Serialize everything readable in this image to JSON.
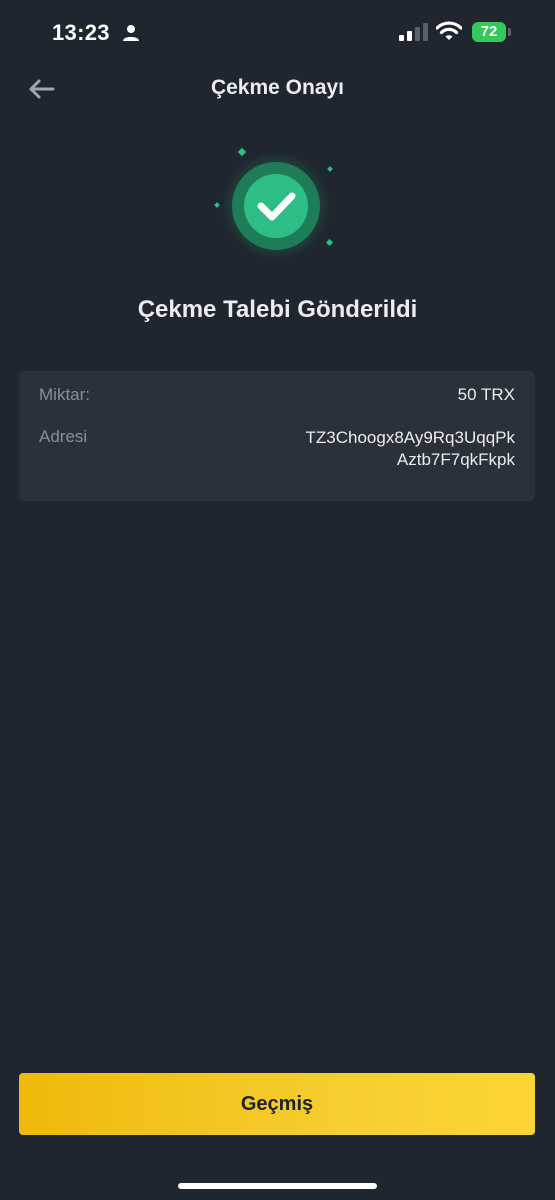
{
  "status_bar": {
    "time": "13:23",
    "battery_level": "72",
    "signal_bars_active": 2,
    "icons": [
      "person-icon",
      "cellular-signal-icon",
      "wifi-icon",
      "battery-icon"
    ]
  },
  "header": {
    "title": "Çekme Onayı",
    "back_icon": "arrow-left-icon"
  },
  "success": {
    "icon": "check-circle-icon",
    "heading": "Çekme Talebi Gönderildi"
  },
  "details": {
    "amount_label": "Miktar:",
    "amount_value": "50 TRX",
    "address_label": "Adresi",
    "address_line1": "TZ3Choogx8Ay9Rq3UqqPk",
    "address_line2": "Aztb7F7qkFkpk"
  },
  "actions": {
    "history_button": "Geçmiş"
  },
  "colors": {
    "background": "#1f2630",
    "card": "#2b313a",
    "accent_yellow": "#f0b90b",
    "success_green": "#2ebd85",
    "muted_text": "#848e9c"
  }
}
